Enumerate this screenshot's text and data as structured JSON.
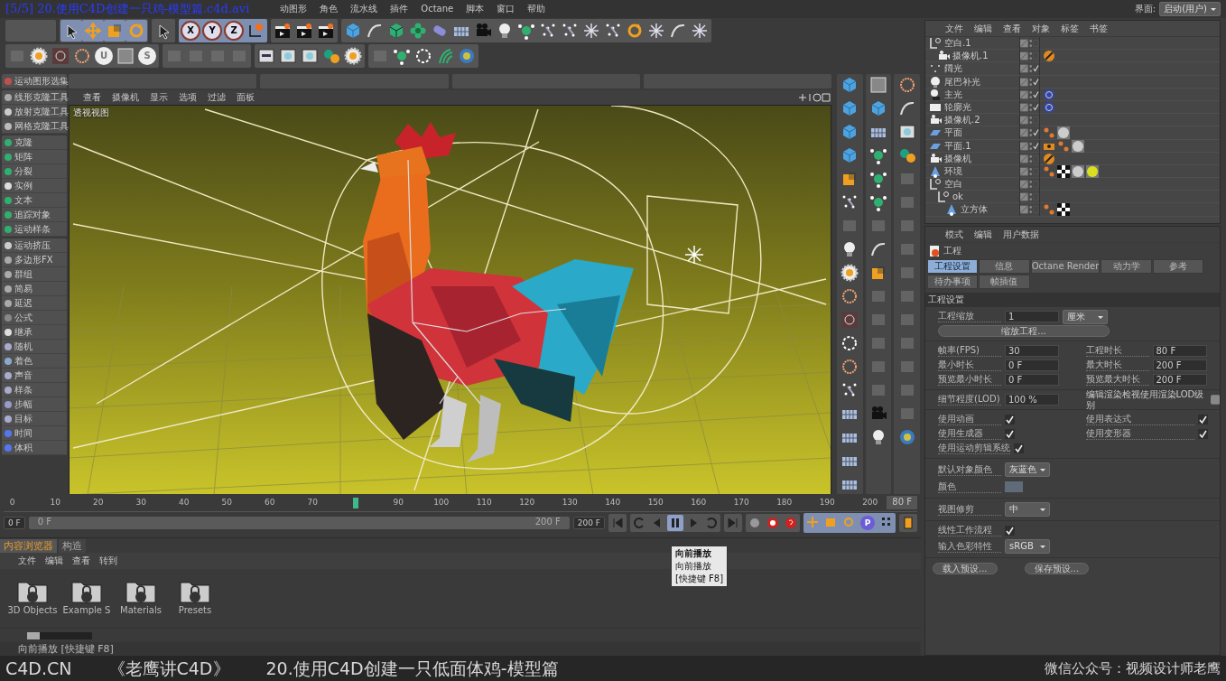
{
  "title_overlay": "[5/5] 20.使用C4D创建一只鸡-模型篇.c4d.avi",
  "menu": [
    "动图形",
    "角色",
    "流水线",
    "插件",
    "Octane",
    "脚本",
    "窗口",
    "帮助"
  ],
  "layout": {
    "label": "界面:",
    "value": "启动(用户)"
  },
  "axis_buttons": [
    "X",
    "Y",
    "Z"
  ],
  "mode_buttons": [
    "U",
    "S"
  ],
  "palette_groups": [
    [
      "运动图形选集"
    ],
    [
      "线形克隆工具",
      "放射克隆工具",
      "网格克隆工具"
    ],
    [
      "克隆",
      "矩阵",
      "分裂",
      "实例",
      "文本",
      "追踪对象",
      "运动样条"
    ],
    [
      "运动挤压",
      "多边形FX",
      "群组",
      "简易",
      "延迟",
      "公式",
      "继承",
      "随机",
      "着色",
      "声音",
      "样条",
      "步幅",
      "目标",
      "时间",
      "体积"
    ]
  ],
  "viewport": {
    "menu": [
      "查看",
      "摄像机",
      "显示",
      "选项",
      "过滤",
      "面板"
    ],
    "label": "透视视图"
  },
  "object_manager": {
    "menu": [
      "文件",
      "编辑",
      "查看",
      "对象",
      "标签",
      "书签"
    ],
    "tree": [
      {
        "name": "空白.1",
        "kind": "null",
        "checked": false,
        "children": [
          {
            "name": "摄像机.1",
            "kind": "camera",
            "checked": false,
            "tags": [
              {
                "kind": "protection"
              }
            ]
          }
        ]
      },
      {
        "name": "阔光",
        "kind": "arealight",
        "checked": true
      },
      {
        "name": "尾巴补光",
        "kind": "light",
        "checked": true
      },
      {
        "name": "主光",
        "kind": "spotlight",
        "checked": true,
        "tags": [
          {
            "kind": "target"
          }
        ]
      },
      {
        "name": "轮廓光",
        "kind": "panel",
        "checked": true,
        "tags": [
          {
            "kind": "target"
          }
        ]
      },
      {
        "name": "摄像机.2",
        "kind": "camera",
        "checked": false
      },
      {
        "name": "平面",
        "kind": "plane",
        "checked": true,
        "tags": [
          {
            "kind": "phong"
          },
          {
            "kind": "material"
          }
        ]
      },
      {
        "name": "平面.1",
        "kind": "plane",
        "checked": true,
        "tags": [
          {
            "kind": "display"
          },
          {
            "kind": "phong"
          },
          {
            "kind": "material"
          }
        ]
      },
      {
        "name": "摄像机",
        "kind": "camera",
        "checked": false,
        "tags": [
          {
            "kind": "protection"
          }
        ]
      },
      {
        "name": "环境",
        "kind": "environment",
        "checked": false,
        "tags": [
          {
            "kind": "phong"
          },
          {
            "kind": "checker"
          },
          {
            "kind": "material"
          },
          {
            "kind": "yellowball"
          }
        ]
      },
      {
        "name": "空白",
        "kind": "null",
        "checked": false,
        "children": [
          {
            "name": "ok",
            "kind": "null",
            "checked": false,
            "children": [
              {
                "name": "立方体",
                "kind": "environment",
                "checked": false,
                "tags": [
                  {
                    "kind": "phong"
                  },
                  {
                    "kind": "checker"
                  }
                ]
              }
            ]
          }
        ]
      }
    ]
  },
  "attributes": {
    "menu": [
      "模式",
      "编辑",
      "用户数据"
    ],
    "object": "工程",
    "tabs": [
      {
        "label": "工程设置",
        "selected": true
      },
      {
        "label": "信息",
        "selected": false
      },
      {
        "label": "Octane Render",
        "selected": false
      },
      {
        "label": "动力学",
        "selected": false
      },
      {
        "label": "参考",
        "selected": false
      },
      {
        "label": "待办事项",
        "selected": false
      },
      {
        "label": "帧插值",
        "selected": false
      }
    ],
    "section": "工程设置",
    "scale": {
      "label": "工程缩放",
      "value": "1",
      "unit": "厘米"
    },
    "scale_button": "缩放工程...",
    "time_fields": [
      {
        "label": "帧率(FPS)",
        "value": "30"
      },
      {
        "label": "工程时长",
        "value": "80 F"
      },
      {
        "label": "最小时长",
        "value": "0 F"
      },
      {
        "label": "最大时长",
        "value": "200 F"
      },
      {
        "label": "预览最小时长",
        "value": "0 F"
      },
      {
        "label": "预览最大时长",
        "value": "200 F"
      }
    ],
    "lod": {
      "label": "细节程度(LOD)",
      "value": "100 %"
    },
    "lod_render": {
      "label": "编辑渲染检视使用渲染LOD级别",
      "checked": false
    },
    "switches": [
      {
        "label": "使用动画",
        "checked": true
      },
      {
        "label": "使用表达式",
        "checked": true
      },
      {
        "label": "使用生成器",
        "checked": true
      },
      {
        "label": "使用变形器",
        "checked": true
      },
      {
        "label": "使用运动剪辑系统",
        "checked": true
      }
    ],
    "default_color": {
      "label": "默认对象颜色",
      "value": "灰蓝色"
    },
    "color": {
      "label": "颜色",
      "color": "#5f6b78"
    },
    "view_clip": {
      "label": "视图修剪",
      "value": "中"
    },
    "linear": {
      "label": "线性工作流程",
      "checked": true
    },
    "input_color": {
      "label": "输入色彩特性",
      "value": "sRGB"
    },
    "buttons": [
      "载入预设...",
      "保存预设..."
    ]
  },
  "timeline": {
    "ticks": [
      "0",
      "10",
      "20",
      "30",
      "40",
      "50",
      "60",
      "70",
      "90",
      "100",
      "110",
      "120",
      "130",
      "140",
      "150",
      "160",
      "170",
      "180",
      "190",
      "200"
    ],
    "playhead": {
      "level": 0.4
    },
    "current_frame": "80 F",
    "start": "0 F",
    "range": {
      "start": "0 F",
      "end": "200 F",
      "level": 1
    },
    "end": "200 F",
    "playback_letter": "P"
  },
  "tooltip": [
    "向前播放",
    "向前播放",
    "[快捷键 F8]"
  ],
  "content_browser": {
    "tabs": [
      {
        "label": "内容浏览器",
        "selected": true
      },
      {
        "label": "构造",
        "selected": false
      }
    ],
    "menu": [
      "文件",
      "编辑",
      "查看",
      "转到"
    ],
    "folders": [
      "3D Objects",
      "Example S",
      "Materials",
      "Presets"
    ],
    "thumbnail_size": {
      "level": 0.2
    }
  },
  "status": "向前播放 [快捷键 F8]",
  "caption": [
    "C4D.CN",
    "《老鹰讲C4D》",
    "20.使用C4D创建一只低面体鸡-模型篇",
    "微信公众号：视频设计师老鹰"
  ]
}
